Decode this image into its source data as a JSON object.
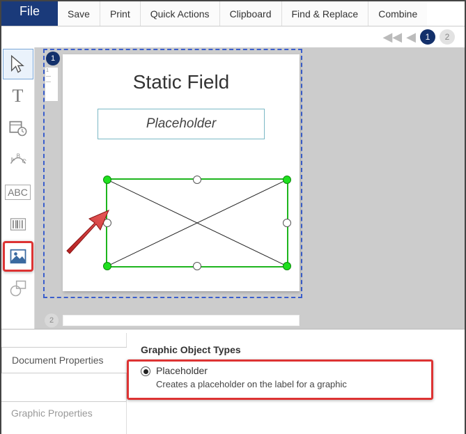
{
  "ribbon": {
    "file": "File",
    "save": "Save",
    "print": "Print",
    "quick": "Quick Actions",
    "clipboard": "Clipboard",
    "find": "Find & Replace",
    "combine": "Combine"
  },
  "nav": {
    "page1": "1",
    "page2": "2"
  },
  "canvas": {
    "badge1": "1",
    "title": "Static Field",
    "placeholder": "Placeholder",
    "badge2": "2"
  },
  "tools": {
    "abc": "ABC",
    "t": "T"
  },
  "props": {
    "tab_doc": "Document Properties",
    "tab_graphic": "Graphic Properties",
    "title": "Graphic Object Types",
    "opt_label": "Placeholder",
    "opt_desc": "Creates a placeholder on the label for a graphic"
  }
}
